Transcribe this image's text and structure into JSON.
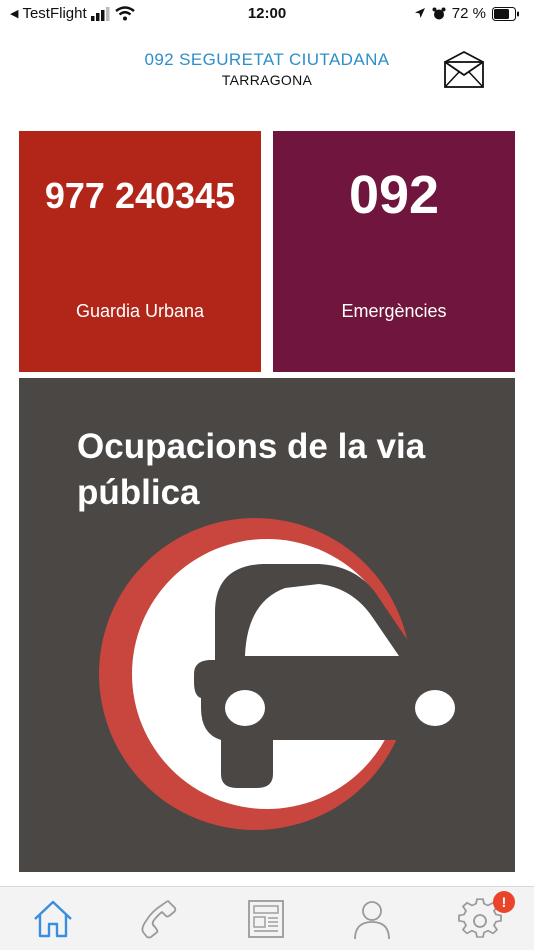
{
  "status_bar": {
    "back_app": "TestFlight",
    "time": "12:00",
    "battery": "72 %"
  },
  "header": {
    "title": "092 SEGURETAT CIUTADANA",
    "subtitle": "TARRAGONA",
    "mail_icon": "envelope-icon"
  },
  "tiles": [
    {
      "number": "977 240345",
      "label": "Guardia Urbana",
      "color": "#b2261a"
    },
    {
      "number": "092",
      "label": "Emergències",
      "color": "#70153d"
    }
  ],
  "banner": {
    "title": "Ocupacions de la via pública",
    "background": "#4a4745",
    "ring_color": "#c8463e",
    "icon": "car-icon"
  },
  "tab_bar": {
    "items": [
      {
        "name": "home",
        "icon": "home-icon",
        "active": true
      },
      {
        "name": "phone",
        "icon": "phone-icon",
        "active": false
      },
      {
        "name": "news",
        "icon": "newspaper-icon",
        "active": false
      },
      {
        "name": "profile",
        "icon": "user-icon",
        "active": false
      },
      {
        "name": "settings",
        "icon": "gear-icon",
        "active": false
      }
    ],
    "settings_badge": "!",
    "active_color": "#3a8ee0",
    "inactive_color": "#9a9a9a"
  }
}
